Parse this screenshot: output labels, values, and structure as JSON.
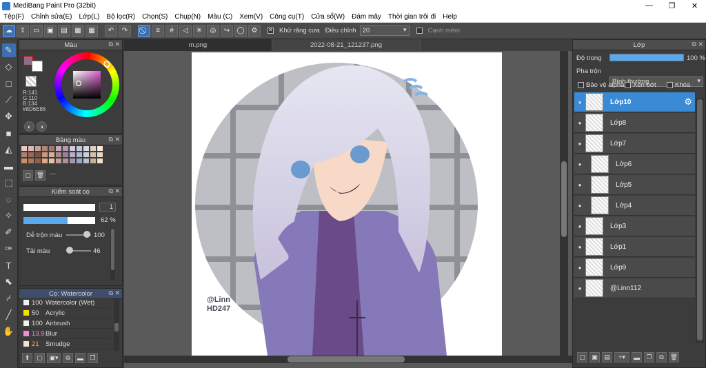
{
  "window": {
    "title": "MediBang Paint Pro (32bit)",
    "min": "—",
    "max": "❐",
    "close": "✕"
  },
  "menu": [
    "Tệp(F)",
    "Chỉnh sửa(E)",
    "Lớp(L)",
    "Bộ lọc(R)",
    "Chọn(S)",
    "Chụp(N)",
    "Màu (C)",
    "Xem(V)",
    "Công cụ(T)",
    "Cửa sổ(W)",
    "Đám mây",
    "Thời gian trôi đi",
    "Help"
  ],
  "toolbar": {
    "antialias_label": "Khử răng cưa",
    "adjust_label": "Điều chỉnh",
    "adjust_value": "20",
    "snap_label": "Cạnh mềm"
  },
  "color_panel": {
    "title": "Màu",
    "r": "R:141",
    "g": "G:110",
    "b": "B:134",
    "hex": "#8D6E86",
    "fg": "#8D6E86"
  },
  "palette_panel": {
    "title": "Bảng màu",
    "more": "---"
  },
  "brush_control": {
    "title": "Kiểm soát cọ",
    "size": "1",
    "opacity": "62 %",
    "opacity_frac": 0.62,
    "mix_label": "Dễ trộn màu",
    "mix_value": "100",
    "load_label": "Tải màu",
    "load_value": "46"
  },
  "brush_panel": {
    "title": "Cọ: Watercolor",
    "items": [
      {
        "size": "100",
        "name": "Watercolor (Wet)",
        "color": "#f0f0f0"
      },
      {
        "size": "50",
        "name": "Acrylic",
        "color": "#f5e000"
      },
      {
        "size": "100",
        "name": "Airbrush",
        "color": "#f0f0f0"
      },
      {
        "size": "13.9",
        "name": "Blur",
        "color": "#f08cd8"
      },
      {
        "size": "21",
        "name": "Smudge",
        "color": "#f7e2c8"
      }
    ]
  },
  "tabs": [
    "m.png",
    "2022-08-21_121237.png"
  ],
  "artwork": {
    "watermark_line1": "@Linn",
    "watermark_line2": "HD247"
  },
  "layer_panel": {
    "title": "Lớp",
    "opacity_label": "Độ trong",
    "opacity_value": "100 %",
    "blend_label": "Pha trộn",
    "blend_value": "Bình thường",
    "protect_alpha": "Bảo vệ alpha",
    "clip": "Xén bớt",
    "lock": "Khóa",
    "layers": [
      {
        "name": "Lớp10",
        "selected": true
      },
      {
        "name": "Lớp8"
      },
      {
        "name": "Lớp7"
      },
      {
        "name": "Lớp6",
        "indent": true
      },
      {
        "name": "Lớp5",
        "indent": true
      },
      {
        "name": "Lớp4",
        "indent": true
      },
      {
        "name": "Lớp3"
      },
      {
        "name": "Lớp1"
      },
      {
        "name": "Lớp9"
      },
      {
        "name": "@Linn112"
      }
    ]
  }
}
